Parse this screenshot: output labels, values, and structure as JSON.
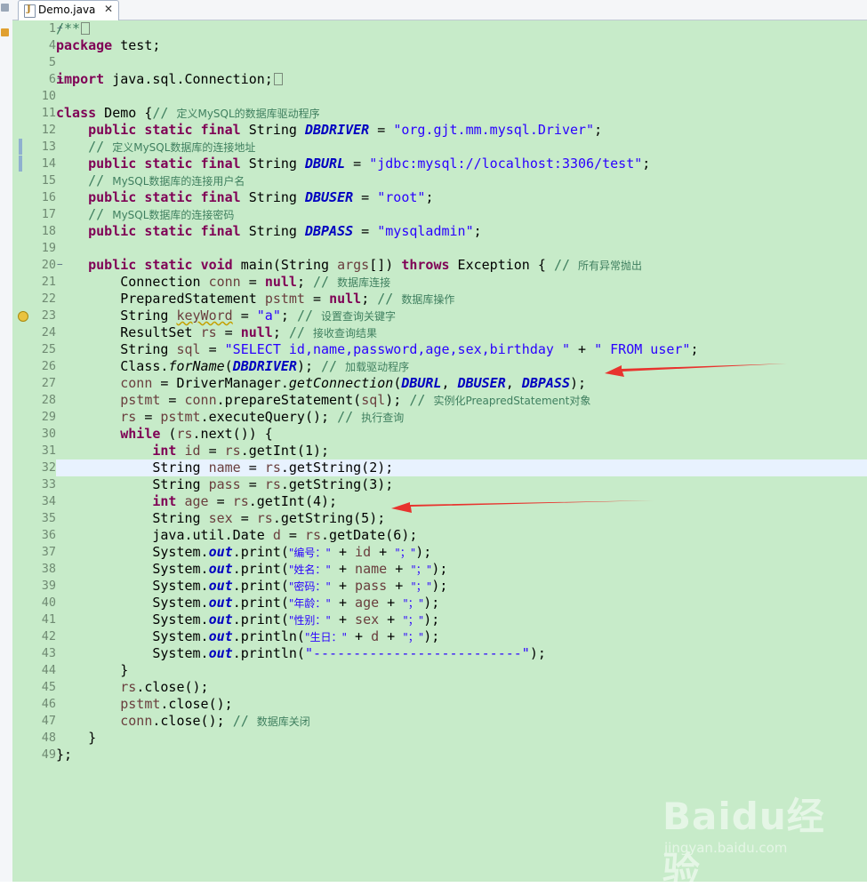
{
  "tab": {
    "label": "Demo.java",
    "close": "✕"
  },
  "line_numbers": [
    "1",
    "4",
    "5",
    "6",
    "10",
    "11",
    "12",
    "13",
    "14",
    "15",
    "16",
    "17",
    "18",
    "19",
    "20",
    "21",
    "22",
    "23",
    "24",
    "25",
    "26",
    "27",
    "28",
    "29",
    "30",
    "31",
    "32",
    "33",
    "34",
    "35",
    "36",
    "37",
    "38",
    "39",
    "40",
    "41",
    "42",
    "43",
    "44",
    "45",
    "46",
    "47",
    "48",
    "49"
  ],
  "code": {
    "l1": "/**",
    "l4_kw": "package",
    "l4_rest": " test;",
    "l6_kw": "import",
    "l6_rest": " java.sql.Connection;",
    "l11_kw": "class",
    "l11_rest": " Demo {",
    "l11_cm": "// ",
    "l11_cmzh": "定义MySQL的数据库驱动程序",
    "ps": "public",
    "st": "static",
    "fn": "final",
    "string": " String ",
    "l12_f": "DBDRIVER",
    "l12_s": "\"org.gjt.mm.mysql.Driver\"",
    "l13_cm": "// ",
    "l13_zh": "定义MySQL数据库的连接地址",
    "l14_f": "DBURL",
    "l14_s": "\"jdbc:mysql://localhost:3306/test\"",
    "l15_cm": "// ",
    "l15_zh": "MySQL数据库的连接用户名",
    "l16_f": "DBUSER",
    "l16_s": "\"root\"",
    "l17_cm": "// ",
    "l17_zh": "MySQL数据库的连接密码",
    "l18_f": "DBPASS",
    "l18_s": "\"mysqladmin\"",
    "l20_void": "void",
    "l20_a": " main(String ",
    "l20_args": "args",
    "l20_b": "[]) ",
    "l20_throws": "throws",
    "l20_c": " Exception { ",
    "l20_cm": "// ",
    "l20_zh": "所有异常抛出",
    "l21_a": "Connection ",
    "l21_v": "conn",
    "l21_b": " = ",
    "null": "null",
    "l21_cm": "// ",
    "l21_zh": "数据库连接",
    "l22_a": "PreparedStatement ",
    "l22_v": "pstmt",
    "l22_zh": "数据库操作",
    "l23_a": "String ",
    "l23_v": "keyWord",
    "l23_s": "\"a\"",
    "l23_zh": "设置查询关键字",
    "l24_a": "ResultSet ",
    "l24_v": "rs",
    "l24_zh": "接收查询结果",
    "l25_a": "String ",
    "l25_v": "sql",
    "l25_s1": "\"SELECT id,name,password,age,sex,birthday \"",
    "l25_s2": "\" FROM user\"",
    "l26_a": "Class.",
    "l26_m": "forName",
    "l26_zh": "加载驱动程序",
    "l27_v": "conn",
    "l27_a": " = DriverManager.",
    "l27_m": "getConnection",
    "l28_v": "pstmt",
    "l28_a": " = ",
    "l28_v2": "conn",
    "l28_b": ".prepareStatement(",
    "l28_v3": "sql",
    "l28_zh": "实例化PreapredStatement对象",
    "l29_v": "rs",
    "l29_a": " = ",
    "l29_v2": "pstmt",
    "l29_b": ".executeQuery(); ",
    "l29_zh": "执行查询",
    "l30_kw": "while",
    "l30_a": " (",
    "l30_v": "rs",
    "l30_b": ".next()) {",
    "int": "int",
    "l31_v": "id",
    "l31_v2": "rs",
    "l31_b": ".getInt(1);",
    "l32_v": "name",
    "l32_b": ".getString(2);",
    "l33_v": "pass",
    "l33_b": ".getString(3);",
    "l34_v": "age",
    "l34_b": ".getInt(4);",
    "l35_v": "sex",
    "l35_b": ".getString(5);",
    "l36_a": "java.util.Date ",
    "l36_v": "d",
    "l36_b": ".getDate(6);",
    "sys": "System.",
    "out": "out",
    "print": ".print(",
    "println": ".println(",
    "l37_s": "\"编号：\"",
    "l38_s": "\"姓名：\"",
    "l39_s": "\"密码：\"",
    "l40_s": "\"年龄：\"",
    "l41_s": "\"性别：\"",
    "l42_s": "\"生日：\"",
    "semi_s": "\"；\"",
    "l43_s": "\"--------------------------\"",
    "l44": "}",
    "l45_v": "rs",
    "close": ".close();",
    "l46_v": "pstmt",
    "l47_v": "conn",
    "l47_zh": "数据库关闭",
    "l48": "}",
    "l49": "};"
  },
  "watermark": {
    "brand": "Baidu经验",
    "sub": "jingyan.baidu.com"
  },
  "colors": {
    "editor_bg": "#c7ebc9",
    "keyword": "#7f0055",
    "string": "#2a00ff",
    "comment": "#3f7f5f",
    "field": "#0000c0",
    "arrow": "#e8332e"
  }
}
